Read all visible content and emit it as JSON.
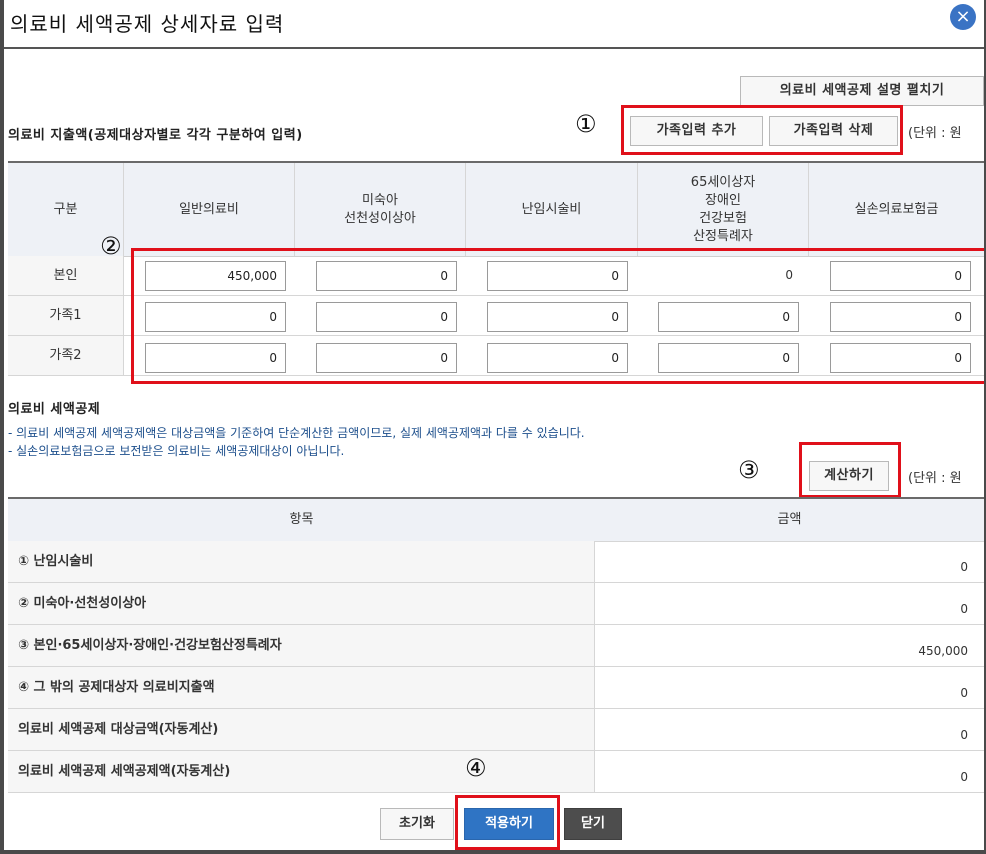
{
  "dialog": {
    "title": "의료비 세액공제 상세자료 입력",
    "close": "×"
  },
  "expand_button": "의료비 세액공제 설명 펼치기",
  "expense_section": {
    "title": "의료비 지출액(공제대상자별로 각각 구분하여 입력)",
    "add_family": "가족입력 추가",
    "delete_family": "가족입력 삭제",
    "unit": "(단위 : 원"
  },
  "expense_table": {
    "headers": {
      "category": "구분",
      "general": "일반의료비",
      "premature_l1": "미숙아",
      "premature_l2": "선천성이상아",
      "infertility": "난임시술비",
      "special_l1": "65세이상자",
      "special_l2": "장애인",
      "special_l3": "건강보험",
      "special_l4": "산정특례자",
      "insurance": "실손의료보험금"
    },
    "rows": [
      {
        "label": "본인",
        "general": "450,000",
        "premature": "0",
        "infertility": "0",
        "special": "0",
        "insurance": "0"
      },
      {
        "label": "가족1",
        "general": "0",
        "premature": "0",
        "infertility": "0",
        "special": "0",
        "insurance": "0"
      },
      {
        "label": "가족2",
        "general": "0",
        "premature": "0",
        "infertility": "0",
        "special": "0",
        "insurance": "0"
      }
    ]
  },
  "credit_section": {
    "title": "의료비 세액공제",
    "note1": "- 의료비 세액공제 세액공제액은 대상금액을 기준하여 단순계산한 금액이므로, 실제 세액공제액과 다를 수 있습니다.",
    "note2": "- 실손의료보험금으로 보전받은 의료비는 세액공제대상이 아닙니다.",
    "calculate": "계산하기",
    "unit": "(단위 : 원"
  },
  "result_table": {
    "header_item": "항목",
    "header_amount": "금액",
    "rows": [
      {
        "item": "① 난임시술비",
        "amount": "0"
      },
      {
        "item": "② 미숙아·선천성이상아",
        "amount": "0"
      },
      {
        "item": "③ 본인·65세이상자·장애인·건강보험산정특례자",
        "amount": "450,000"
      },
      {
        "item": "④ 그 밖의 공제대상자 의료비지출액",
        "amount": "0"
      },
      {
        "item": "의료비 세액공제 대상금액(자동계산)",
        "amount": "0"
      },
      {
        "item": "의료비 세액공제 세액공제액(자동계산)",
        "amount": "0"
      }
    ]
  },
  "footer": {
    "reset": "초기화",
    "apply": "적용하기",
    "close": "닫기"
  },
  "markers": {
    "m1": "①",
    "m2": "②",
    "m3": "③",
    "m4": "④"
  },
  "colors": {
    "highlight": "#e0101a",
    "primary_button": "#2f74c4",
    "dark_button": "#4d4d4d",
    "header_bg": "#eef1f6"
  }
}
